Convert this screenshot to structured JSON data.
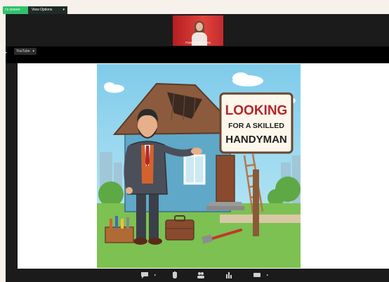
{
  "topbar": {
    "share_pill": "r's screen",
    "view_options": "View Options",
    "chevron_icon": "chevron-down-icon"
  },
  "participant": {
    "name": "FutureSkills Hana"
  },
  "shared_app": {
    "label": "YouTube",
    "chevron_icon": "chevron-down-icon"
  },
  "illustration": {
    "sign_line1": "LOOKING",
    "sign_line2": "FOR A SKILLED",
    "sign_line3": "HANDYMAN"
  },
  "toolbar": {
    "icons": [
      "chat-icon",
      "raise-hand-icon",
      "participants-icon",
      "polls-icon",
      "more-icon"
    ]
  },
  "colors": {
    "share_green": "#2ec26b",
    "meeting_bg": "#1b1b1b",
    "thumb_red": "#c7262a",
    "sky": "#8fd3ef",
    "sign_text": "#b3262a"
  }
}
